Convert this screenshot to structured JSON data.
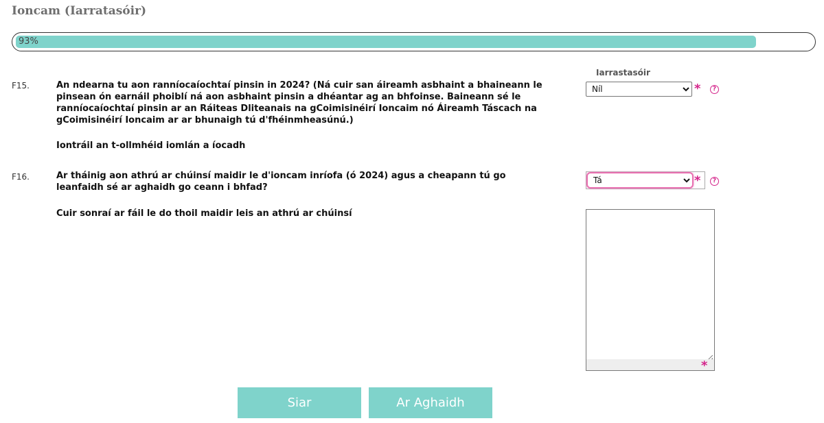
{
  "page": {
    "title": "Ioncam (Iarratasóir)"
  },
  "progress": {
    "label": "93%",
    "value": 0.93
  },
  "column_header": "Iarrastasóir",
  "questions": [
    {
      "number": "F15.",
      "text": "An ndearna tu aon ranníocaíochtaí pinsin in 2024? (Ná cuir san áireamh asbhaint a bhaineann le pinsean ón earnáil phoiblí ná aon asbhaint pinsin a dhéantar ag an bhfoinse. Baineann sé le ranníocaíochtaí pinsin ar an Ráiteas Dliteanais na gCoimisinéirí Ioncaim nó Áireamh Táscach na gCoimisinéirí Ioncaim ar ar bhunaigh tú d'fhéinmheasúnú.)",
      "followup": "Iontráil an t-ollmhéid iomlán a íocadh",
      "answer": "Níl"
    },
    {
      "number": "F16.",
      "text": "Ar tháinig aon athrú ar chúinsí maidir le d'ioncam inríofa (ó 2024) agus a cheapann tú go leanfaidh sé ar aghaidh go ceann i bhfad?",
      "followup": "Cuir sonraí ar fáil le do thoil maidir leis an athrú ar chúinsí",
      "answer": "Tá"
    }
  ],
  "required_marker": "*",
  "help_marker": "?",
  "buttons": {
    "back": "Siar",
    "next": "Ar Aghaidh"
  },
  "colors": {
    "accent": "#7fd3cb",
    "required": "#d4238a",
    "title": "#6e6e6e"
  }
}
